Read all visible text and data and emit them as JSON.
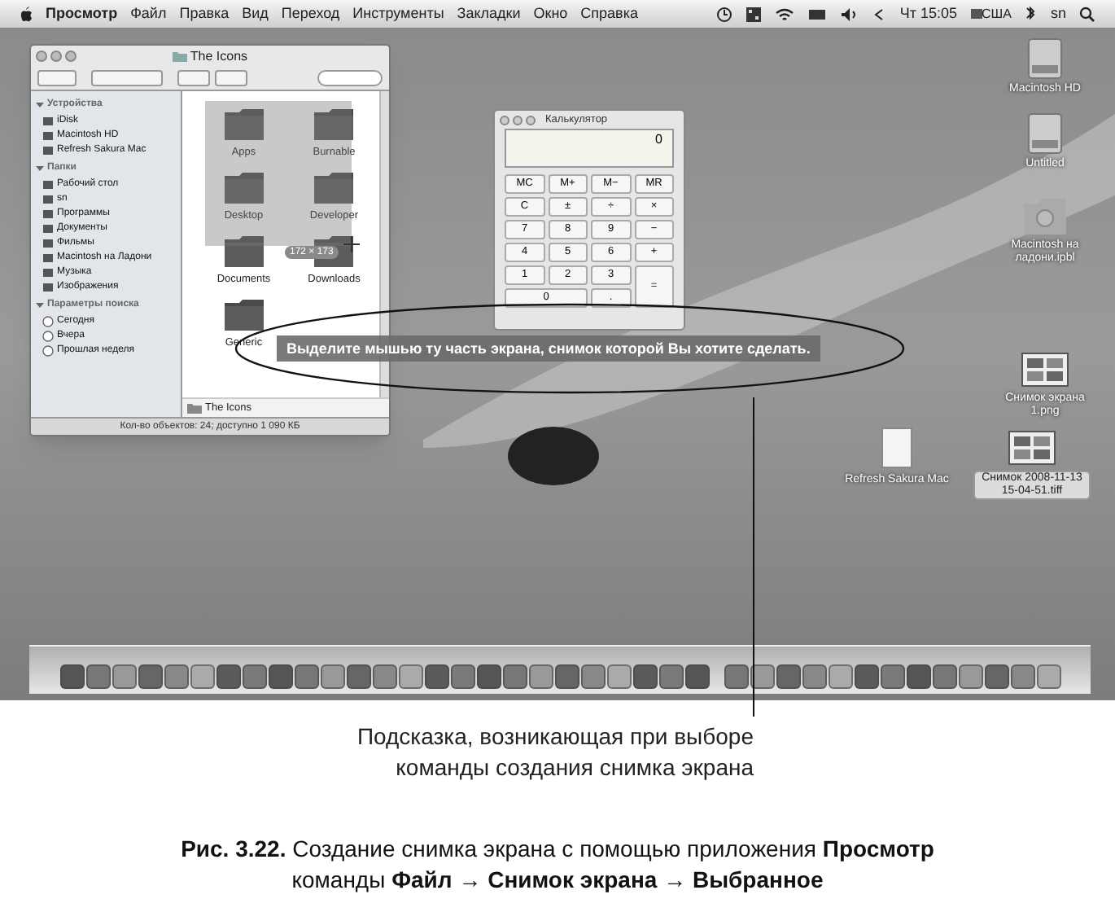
{
  "menu_bar": {
    "app_name": "Просмотр",
    "menus": [
      "Файл",
      "Правка",
      "Вид",
      "Переход",
      "Инструменты",
      "Закладки",
      "Окно",
      "Справка"
    ],
    "clock": "Чт 15:05",
    "input_source": "США",
    "user": "sn"
  },
  "finder": {
    "title": "The Icons",
    "sidebar": [
      {
        "heading": "Устройства",
        "expanded": true,
        "items": [
          "iDisk",
          "Macintosh HD",
          "Refresh Sakura Mac"
        ]
      },
      {
        "heading": "Папки",
        "expanded": true,
        "items": [
          "Рабочий стол",
          "sn",
          "Программы",
          "Документы",
          "Фильмы",
          "Macintosh на Ладони",
          "Музыка",
          "Изображения"
        ]
      },
      {
        "heading": "Параметры поиска",
        "expanded": true,
        "items": [
          "Сегодня",
          "Вчера",
          "Прошлая неделя"
        ]
      }
    ],
    "files": [
      "Apps",
      "Burnable",
      "Desktop",
      "Developer",
      "Documents",
      "Downloads",
      "Generic"
    ],
    "path": "The Icons",
    "status": "Кол-во объектов: 24; доступно 1 090 КБ"
  },
  "capture_size": "172 × 173",
  "calculator": {
    "title": "Калькулятор",
    "display": "0",
    "keys": [
      "MC",
      "M+",
      "M−",
      "MR",
      "C",
      "±",
      "÷",
      "×",
      "7",
      "8",
      "9",
      "−",
      "4",
      "5",
      "6",
      "+",
      "1",
      "2",
      "3",
      "=",
      "0",
      "."
    ]
  },
  "hint": "Выделите мышью ту часть экрана, снимок которой Вы хотите сделать.",
  "desktop_icons": [
    {
      "label": "Macintosh HD",
      "kind": "disk",
      "selected": false
    },
    {
      "label": "Untitled",
      "kind": "disk",
      "selected": false
    },
    {
      "label": "Macintosh на ладони.ipbl",
      "kind": "folder",
      "selected": false
    },
    {
      "label": "Снимок экрана 1.png",
      "kind": "image",
      "selected": false
    },
    {
      "label": "Refresh Sakura Mac",
      "kind": "document",
      "selected": false
    },
    {
      "label": "Снимок 2008-11-13 15-04-51.tiff",
      "kind": "image",
      "selected": true
    }
  ],
  "callout": [
    "Подсказка, возникающая при выборе",
    "команды создания снимка экрана"
  ],
  "caption": [
    "**Рис. 3.22.** Создание снимка экрана с помощью приложения **Просмотр**",
    "команды **Файл → Снимок экрана → Выбранное**"
  ]
}
